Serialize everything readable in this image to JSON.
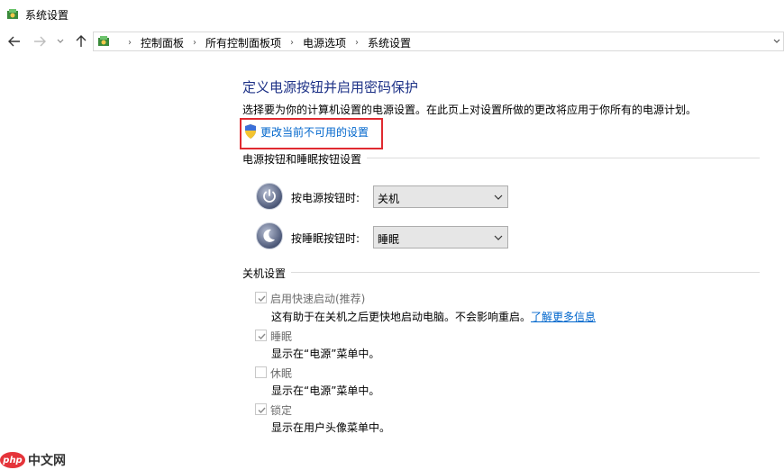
{
  "window": {
    "title": "系统设置"
  },
  "address": {
    "crumbs": [
      "控制面板",
      "所有控制面板项",
      "电源选项",
      "系统设置"
    ]
  },
  "main": {
    "heading": "定义电源按钮并启用密码保护",
    "description": "选择要为你的计算机设置的电源设置。在此页上对设置所做的更改将应用于你所有的电源计划。",
    "change_link": "更改当前不可用的设置",
    "power_group": {
      "title": "电源按钮和睡眠按钮设置",
      "power_button": {
        "label": "按电源按钮时:",
        "value": "关机"
      },
      "sleep_button": {
        "label": "按睡眠按钮时:",
        "value": "睡眠"
      }
    },
    "shutdown_group": {
      "title": "关机设置",
      "options": [
        {
          "label": "启用快速启动(推荐)",
          "desc": "这有助于在关机之后更快地启动电脑。不会影响重启。",
          "link": "了解更多信息",
          "checked": true
        },
        {
          "label": "睡眠",
          "desc": "显示在“电源”菜单中。",
          "checked": true
        },
        {
          "label": "休眠",
          "desc": "显示在“电源”菜单中。",
          "checked": false
        },
        {
          "label": "锁定",
          "desc": "显示在用户头像菜单中。",
          "checked": true
        }
      ]
    }
  },
  "watermark": {
    "logo": "php",
    "text": "中文网"
  },
  "colors": {
    "heading": "#1e3287",
    "link": "#0066cc",
    "highlight_border": "#e02a30"
  }
}
